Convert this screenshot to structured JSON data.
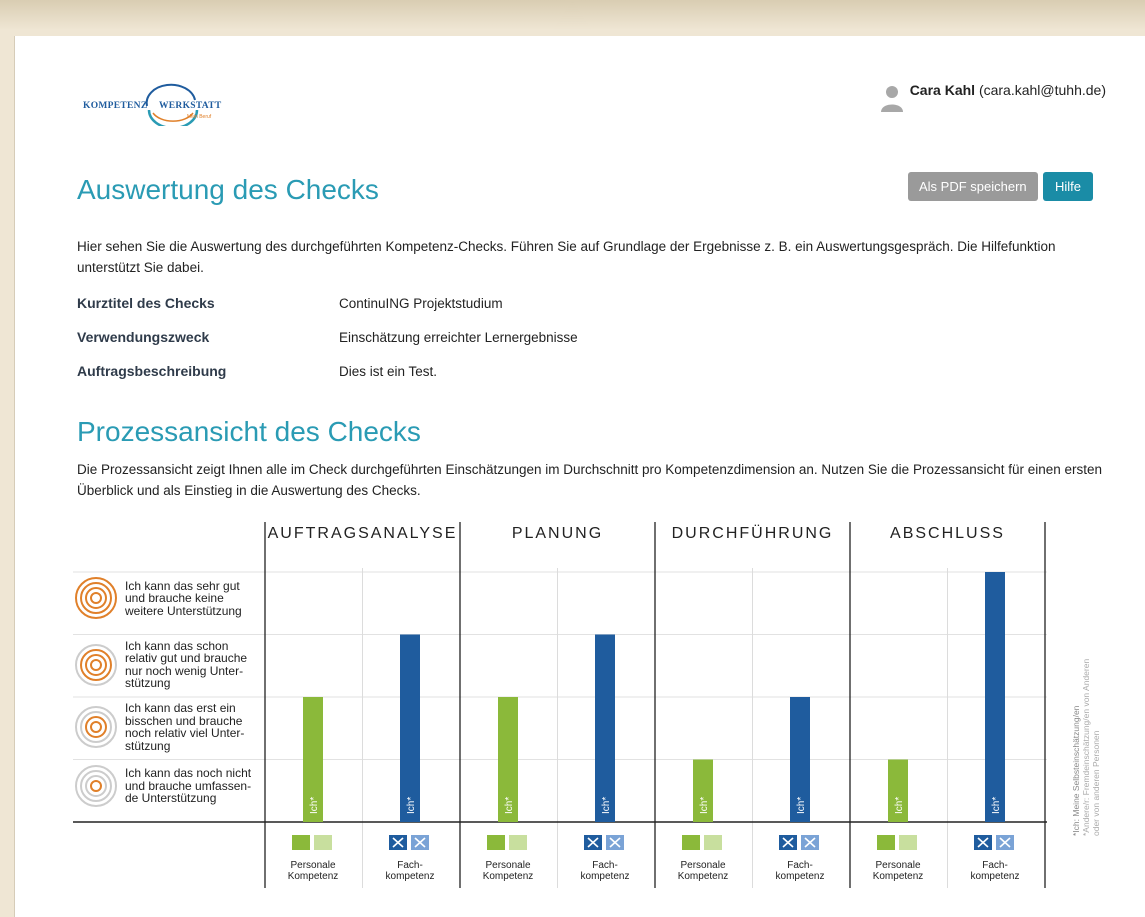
{
  "header": {
    "logo_line1_left": "KOMPETENZ",
    "logo_line1_right": "WERKSTATT",
    "logo_tagline": "Mein Beruf",
    "user_name": "Cara Kahl",
    "user_email": "(cara.kahl@tuhh.de)"
  },
  "toolbar": {
    "pdf_label": "Als PDF speichern",
    "help_label": "Hilfe"
  },
  "evaluation": {
    "title": "Auswertung des Checks",
    "intro": "Hier sehen Sie die Auswertung des durchgeführten Kompetenz-Checks. Führen Sie auf Grundlage der Ergebnisse z. B. ein Auswertungsgespräch. Die Hilfefunktion unterstützt Sie dabei.",
    "fields": [
      {
        "label": "Kurztitel des Checks",
        "value": "ContinuING Projektstudium"
      },
      {
        "label": "Verwendungszweck",
        "value": "Einschätzung erreichter Lernergebnisse"
      },
      {
        "label": "Auftragsbeschreibung",
        "value": "Dies ist ein Test."
      }
    ]
  },
  "process": {
    "title": "Prozessansicht des Checks",
    "description": "Die Prozessansicht zeigt Ihnen alle im Check durchgeführten Einschätzungen im Durchschnitt pro Kompetenzdimension an. Nutzen Sie die Prozessansicht für einen ersten Überblick und als Einstieg in die Auswertung des Checks."
  },
  "chart_data": {
    "type": "bar",
    "phases": [
      "AUFTRAGSANALYSE",
      "PLANUNG",
      "DURCHFÜHRUNG",
      "ABSCHLUSS"
    ],
    "categories": [
      "Personale Kompetenz",
      "Fach-kompetenz"
    ],
    "category_labels": [
      [
        "Personale",
        "Kompetenz"
      ],
      [
        "Fach-",
        "kompetenz"
      ]
    ],
    "series": [
      {
        "name": "Personale Kompetenz",
        "color": "#8bb93a",
        "values": [
          2,
          2,
          1,
          1
        ]
      },
      {
        "name": "Fachkompetenz",
        "color": "#1f5c9e",
        "values": [
          3,
          3,
          2,
          4
        ]
      }
    ],
    "ylim": [
      0,
      4
    ],
    "bar_label": "Ich*",
    "levels": [
      "Ich kann das noch nicht und brauche umfassen-de Unterstützung",
      "Ich kann das erst ein bisschen und brauche noch relativ viel Unter-stützung",
      "Ich kann das schon relativ gut und brauche nur noch wenig Unter-stützung",
      "Ich kann das sehr gut und brauche keine weitere Unterstützung"
    ],
    "level_lines": [
      [
        "Ich kann das noch nicht",
        "und brauche umfassen-",
        "de Unterstützung"
      ],
      [
        "Ich kann das erst ein",
        "bisschen und brauche",
        "noch relativ viel Unter-",
        "stützung"
      ],
      [
        "Ich kann das schon",
        "relativ gut und brauche",
        "nur noch wenig Unter-",
        "stützung"
      ],
      [
        "Ich kann das sehr gut",
        "und brauche keine",
        "weitere Unterstützung"
      ]
    ],
    "side_note": [
      "*Ich: Meine Selbsteinschätzung/en",
      "*Andere/r: Fremdeinschätzung/en von Anderen",
      "oder von anderen Personen"
    ],
    "grid": true
  }
}
